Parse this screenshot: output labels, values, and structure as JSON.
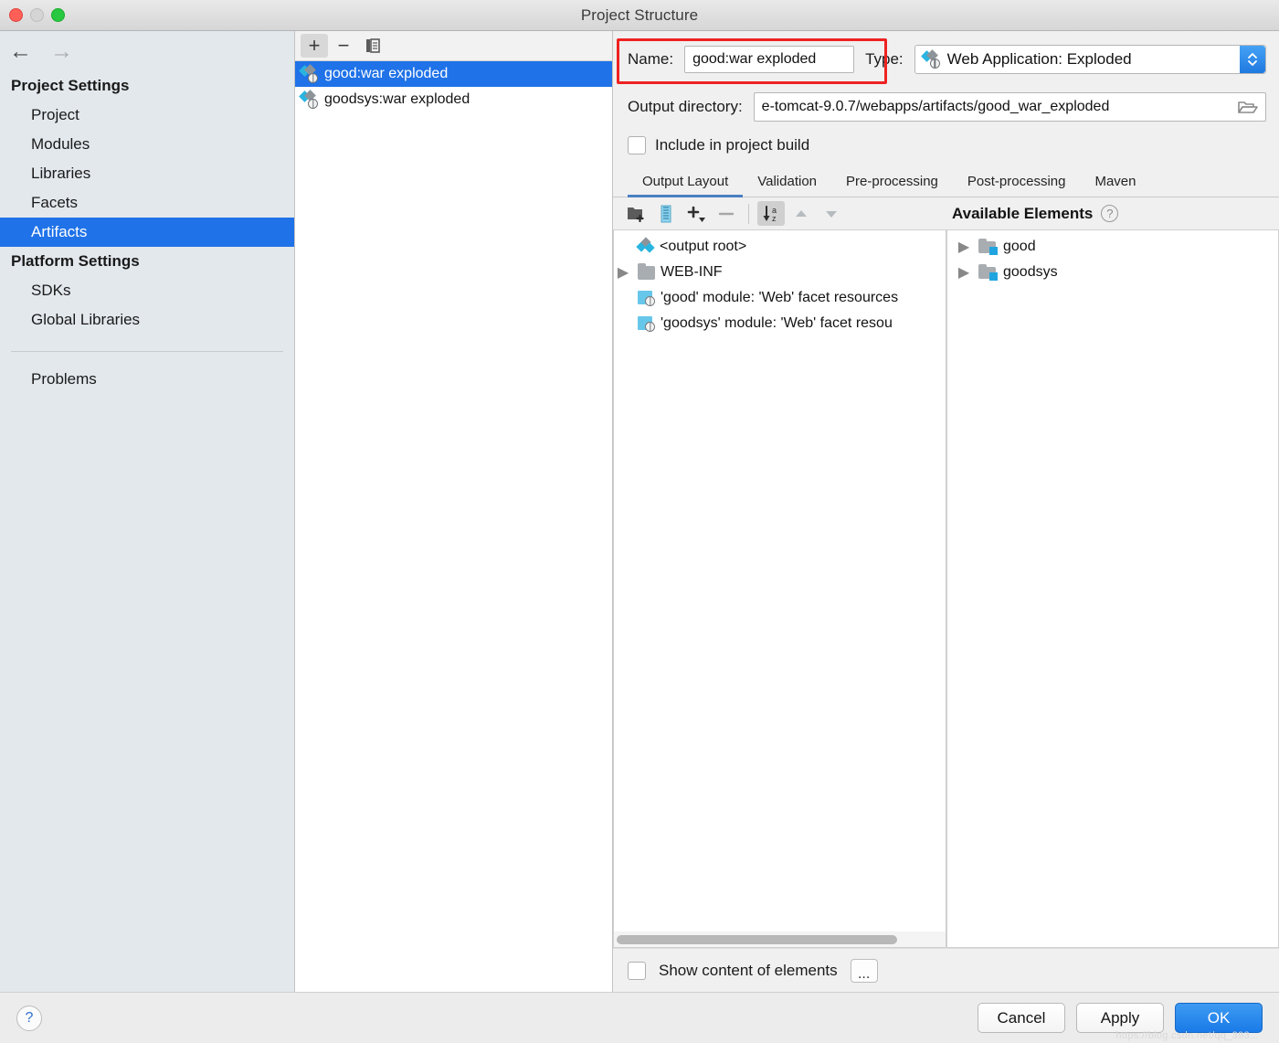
{
  "window": {
    "title": "Project Structure",
    "traffic_lights": [
      "close",
      "minimize",
      "maximize"
    ]
  },
  "nav": {
    "back": "←",
    "forward": "→"
  },
  "sidebar": {
    "groups": [
      {
        "label": "Project Settings",
        "items": [
          {
            "label": "Project",
            "selected": false
          },
          {
            "label": "Modules",
            "selected": false
          },
          {
            "label": "Libraries",
            "selected": false
          },
          {
            "label": "Facets",
            "selected": false
          },
          {
            "label": "Artifacts",
            "selected": true
          }
        ]
      },
      {
        "label": "Platform Settings",
        "items": [
          {
            "label": "SDKs",
            "selected": false
          },
          {
            "label": "Global Libraries",
            "selected": false
          }
        ]
      }
    ],
    "extra": {
      "label": "Problems"
    }
  },
  "artifacts_panel": {
    "toolbar": {
      "add": "+",
      "remove": "−",
      "copy_icon": "copy-icon"
    },
    "items": [
      {
        "label": "good:war exploded",
        "selected": true
      },
      {
        "label": "goodsys:war exploded",
        "selected": false
      }
    ]
  },
  "detail": {
    "name_label": "Name:",
    "name_value": "good:war exploded",
    "name_highlight_color": "#ee2222",
    "type_label": "Type:",
    "type_value": "Web Application: Exploded",
    "output_label": "Output directory:",
    "output_value": "e-tomcat-9.0.7/webapps/artifacts/good_war_exploded",
    "include_checkbox": {
      "label": "Include in project build",
      "checked": false
    },
    "tabs": [
      {
        "label": "Output Layout",
        "active": true
      },
      {
        "label": "Validation",
        "active": false
      },
      {
        "label": "Pre-processing",
        "active": false
      },
      {
        "label": "Post-processing",
        "active": false
      },
      {
        "label": "Maven",
        "active": false
      }
    ]
  },
  "layout_toolbar": {
    "buttons": [
      {
        "name": "new-directory-icon",
        "pressed": false
      },
      {
        "name": "create-archive-icon",
        "pressed": false
      },
      {
        "name": "add-copy-icon",
        "pressed": false
      },
      {
        "name": "remove-icon",
        "pressed": false
      },
      {
        "name": "sort-alphabetically-icon",
        "pressed": true
      },
      {
        "name": "move-up-icon",
        "pressed": false
      },
      {
        "name": "move-down-icon",
        "pressed": false
      }
    ]
  },
  "output_tree": {
    "rows": [
      {
        "label": "<output root>",
        "icon": "artifact-root-icon",
        "twisty": false
      },
      {
        "label": "WEB-INF",
        "icon": "folder-icon",
        "twisty": true
      },
      {
        "label": "'good' module: 'Web' facet resources",
        "icon": "module-web-icon",
        "twisty": false
      },
      {
        "label": "'goodsys' module: 'Web' facet resou",
        "icon": "module-web-icon",
        "twisty": false
      }
    ]
  },
  "available_elements": {
    "title": "Available Elements",
    "help": "?",
    "rows": [
      {
        "label": "good",
        "icon": "module-folder-icon",
        "twisty": true
      },
      {
        "label": "goodsys",
        "icon": "module-folder-icon",
        "twisty": true
      }
    ]
  },
  "footer": {
    "show_content_checkbox": {
      "label": "Show content of elements",
      "checked": false
    },
    "more_button": "...",
    "help_button": "?",
    "buttons": [
      {
        "label": "Cancel",
        "primary": false
      },
      {
        "label": "Apply",
        "primary": false
      },
      {
        "label": "OK",
        "primary": true
      }
    ],
    "watermark": "https://blog.csdn.net/qq_393..."
  }
}
